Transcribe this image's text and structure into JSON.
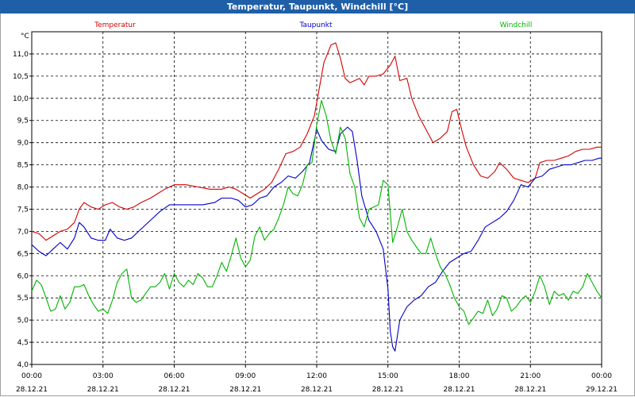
{
  "window": {
    "title": "Temperatur, Taupunkt, Windchill [°C]"
  },
  "colors": {
    "temperature": "#d40000",
    "dewpoint": "#0000c8",
    "windchill": "#00b400",
    "titlebar": "#1f5fa8",
    "grid": "#000000"
  },
  "chart_data": {
    "type": "line",
    "title": "Temperatur, Taupunkt, Windchill [°C]",
    "ylabel": "°C",
    "ylim": [
      4.0,
      11.5
    ],
    "xlim": [
      0,
      24
    ],
    "grid": true,
    "legend_position": "top",
    "y_ticks": [
      "4,0",
      "4,5",
      "5,0",
      "5,5",
      "6,0",
      "6,5",
      "7,0",
      "7,5",
      "8,0",
      "8,5",
      "9,0",
      "9,5",
      "10,0",
      "10,5",
      "11,0"
    ],
    "x_ticks": [
      {
        "time": "00:00",
        "date": "28.12.21"
      },
      {
        "time": "03:00",
        "date": "28.12.21"
      },
      {
        "time": "06:00",
        "date": "28.12.21"
      },
      {
        "time": "09:00",
        "date": "28.12.21"
      },
      {
        "time": "12:00",
        "date": "28.12.21"
      },
      {
        "time": "15:00",
        "date": "28.12.21"
      },
      {
        "time": "18:00",
        "date": "28.12.21"
      },
      {
        "time": "21:00",
        "date": "28.12.21"
      },
      {
        "time": "00:00",
        "date": "29.12.21"
      }
    ],
    "x_unit": "hours since 28.12.21 00:00",
    "series": [
      {
        "name": "Temperatur",
        "points": [
          [
            0,
            7.0
          ],
          [
            0.3,
            6.95
          ],
          [
            0.6,
            6.8
          ],
          [
            0.9,
            6.9
          ],
          [
            1.2,
            7.0
          ],
          [
            1.5,
            7.05
          ],
          [
            1.8,
            7.2
          ],
          [
            2.0,
            7.5
          ],
          [
            2.2,
            7.65
          ],
          [
            2.5,
            7.55
          ],
          [
            2.8,
            7.5
          ],
          [
            3.1,
            7.6
          ],
          [
            3.4,
            7.65
          ],
          [
            3.7,
            7.55
          ],
          [
            4.0,
            7.5
          ],
          [
            4.3,
            7.55
          ],
          [
            4.6,
            7.65
          ],
          [
            5.0,
            7.75
          ],
          [
            5.3,
            7.85
          ],
          [
            5.6,
            7.95
          ],
          [
            6.0,
            8.05
          ],
          [
            6.5,
            8.05
          ],
          [
            7.0,
            8.0
          ],
          [
            7.5,
            7.95
          ],
          [
            8.0,
            7.95
          ],
          [
            8.3,
            8.0
          ],
          [
            8.6,
            7.95
          ],
          [
            8.9,
            7.85
          ],
          [
            9.2,
            7.75
          ],
          [
            9.5,
            7.85
          ],
          [
            9.8,
            7.95
          ],
          [
            10.1,
            8.1
          ],
          [
            10.4,
            8.4
          ],
          [
            10.7,
            8.75
          ],
          [
            11.0,
            8.8
          ],
          [
            11.3,
            8.9
          ],
          [
            11.6,
            9.2
          ],
          [
            11.9,
            9.6
          ],
          [
            12.1,
            10.2
          ],
          [
            12.3,
            10.8
          ],
          [
            12.6,
            11.2
          ],
          [
            12.8,
            11.25
          ],
          [
            13.0,
            10.9
          ],
          [
            13.2,
            10.45
          ],
          [
            13.4,
            10.35
          ],
          [
            13.6,
            10.4
          ],
          [
            13.8,
            10.45
          ],
          [
            14.0,
            10.3
          ],
          [
            14.2,
            10.5
          ],
          [
            14.5,
            10.5
          ],
          [
            14.8,
            10.55
          ],
          [
            15.1,
            10.75
          ],
          [
            15.3,
            10.95
          ],
          [
            15.5,
            10.4
          ],
          [
            15.8,
            10.45
          ],
          [
            16.0,
            10.0
          ],
          [
            16.3,
            9.6
          ],
          [
            16.6,
            9.3
          ],
          [
            16.9,
            9.0
          ],
          [
            17.2,
            9.1
          ],
          [
            17.5,
            9.25
          ],
          [
            17.7,
            9.7
          ],
          [
            17.9,
            9.75
          ],
          [
            18.1,
            9.3
          ],
          [
            18.3,
            8.9
          ],
          [
            18.6,
            8.5
          ],
          [
            18.9,
            8.25
          ],
          [
            19.2,
            8.2
          ],
          [
            19.5,
            8.35
          ],
          [
            19.7,
            8.55
          ],
          [
            20.0,
            8.4
          ],
          [
            20.3,
            8.2
          ],
          [
            20.6,
            8.15
          ],
          [
            20.9,
            8.1
          ],
          [
            21.2,
            8.2
          ],
          [
            21.4,
            8.55
          ],
          [
            21.7,
            8.6
          ],
          [
            22.0,
            8.6
          ],
          [
            22.3,
            8.65
          ],
          [
            22.6,
            8.7
          ],
          [
            22.9,
            8.8
          ],
          [
            23.2,
            8.85
          ],
          [
            23.5,
            8.85
          ],
          [
            23.8,
            8.9
          ],
          [
            24.0,
            8.9
          ]
        ]
      },
      {
        "name": "Taupunkt",
        "points": [
          [
            0,
            6.7
          ],
          [
            0.3,
            6.55
          ],
          [
            0.6,
            6.45
          ],
          [
            0.9,
            6.6
          ],
          [
            1.2,
            6.75
          ],
          [
            1.5,
            6.6
          ],
          [
            1.8,
            6.85
          ],
          [
            2.0,
            7.2
          ],
          [
            2.2,
            7.1
          ],
          [
            2.5,
            6.85
          ],
          [
            2.8,
            6.8
          ],
          [
            3.1,
            6.8
          ],
          [
            3.3,
            7.05
          ],
          [
            3.6,
            6.85
          ],
          [
            3.9,
            6.8
          ],
          [
            4.2,
            6.85
          ],
          [
            4.5,
            7.0
          ],
          [
            4.8,
            7.15
          ],
          [
            5.1,
            7.3
          ],
          [
            5.4,
            7.45
          ],
          [
            5.8,
            7.6
          ],
          [
            6.2,
            7.6
          ],
          [
            6.7,
            7.6
          ],
          [
            7.2,
            7.6
          ],
          [
            7.7,
            7.65
          ],
          [
            8.0,
            7.75
          ],
          [
            8.4,
            7.75
          ],
          [
            8.7,
            7.7
          ],
          [
            9.0,
            7.55
          ],
          [
            9.3,
            7.6
          ],
          [
            9.6,
            7.75
          ],
          [
            9.9,
            7.8
          ],
          [
            10.2,
            8.0
          ],
          [
            10.5,
            8.1
          ],
          [
            10.8,
            8.25
          ],
          [
            11.1,
            8.2
          ],
          [
            11.4,
            8.35
          ],
          [
            11.7,
            8.55
          ],
          [
            12.0,
            9.3
          ],
          [
            12.2,
            9.05
          ],
          [
            12.5,
            8.85
          ],
          [
            12.8,
            8.8
          ],
          [
            13.0,
            9.2
          ],
          [
            13.3,
            9.35
          ],
          [
            13.5,
            9.25
          ],
          [
            13.7,
            8.6
          ],
          [
            13.9,
            7.8
          ],
          [
            14.2,
            7.25
          ],
          [
            14.5,
            7.0
          ],
          [
            14.8,
            6.6
          ],
          [
            15.0,
            5.7
          ],
          [
            15.1,
            4.75
          ],
          [
            15.2,
            4.4
          ],
          [
            15.3,
            4.3
          ],
          [
            15.5,
            5.0
          ],
          [
            15.8,
            5.3
          ],
          [
            16.1,
            5.45
          ],
          [
            16.4,
            5.55
          ],
          [
            16.7,
            5.75
          ],
          [
            17.0,
            5.85
          ],
          [
            17.3,
            6.1
          ],
          [
            17.6,
            6.3
          ],
          [
            17.9,
            6.4
          ],
          [
            18.2,
            6.5
          ],
          [
            18.5,
            6.55
          ],
          [
            18.8,
            6.8
          ],
          [
            19.1,
            7.1
          ],
          [
            19.4,
            7.2
          ],
          [
            19.7,
            7.3
          ],
          [
            20.0,
            7.45
          ],
          [
            20.3,
            7.7
          ],
          [
            20.6,
            8.05
          ],
          [
            20.9,
            8.0
          ],
          [
            21.2,
            8.2
          ],
          [
            21.5,
            8.25
          ],
          [
            21.8,
            8.4
          ],
          [
            22.1,
            8.45
          ],
          [
            22.4,
            8.5
          ],
          [
            22.7,
            8.5
          ],
          [
            23.0,
            8.55
          ],
          [
            23.3,
            8.6
          ],
          [
            23.6,
            8.6
          ],
          [
            23.9,
            8.65
          ],
          [
            24.0,
            8.65
          ]
        ]
      },
      {
        "name": "Windchill",
        "points": [
          [
            0,
            5.65
          ],
          [
            0.2,
            5.9
          ],
          [
            0.4,
            5.8
          ],
          [
            0.6,
            5.5
          ],
          [
            0.8,
            5.2
          ],
          [
            1.0,
            5.25
          ],
          [
            1.2,
            5.55
          ],
          [
            1.4,
            5.25
          ],
          [
            1.6,
            5.4
          ],
          [
            1.8,
            5.75
          ],
          [
            2.0,
            5.75
          ],
          [
            2.2,
            5.8
          ],
          [
            2.4,
            5.55
          ],
          [
            2.6,
            5.35
          ],
          [
            2.8,
            5.2
          ],
          [
            3.0,
            5.25
          ],
          [
            3.2,
            5.15
          ],
          [
            3.4,
            5.45
          ],
          [
            3.6,
            5.85
          ],
          [
            3.8,
            6.05
          ],
          [
            4.0,
            6.15
          ],
          [
            4.2,
            5.5
          ],
          [
            4.4,
            5.4
          ],
          [
            4.6,
            5.45
          ],
          [
            4.8,
            5.6
          ],
          [
            5.0,
            5.75
          ],
          [
            5.2,
            5.75
          ],
          [
            5.4,
            5.85
          ],
          [
            5.6,
            6.05
          ],
          [
            5.8,
            5.7
          ],
          [
            6.0,
            6.05
          ],
          [
            6.2,
            5.85
          ],
          [
            6.4,
            5.75
          ],
          [
            6.6,
            5.9
          ],
          [
            6.8,
            5.8
          ],
          [
            7.0,
            6.05
          ],
          [
            7.2,
            5.95
          ],
          [
            7.4,
            5.75
          ],
          [
            7.6,
            5.75
          ],
          [
            7.8,
            6.0
          ],
          [
            8.0,
            6.3
          ],
          [
            8.2,
            6.1
          ],
          [
            8.4,
            6.45
          ],
          [
            8.6,
            6.85
          ],
          [
            8.8,
            6.4
          ],
          [
            9.0,
            6.2
          ],
          [
            9.2,
            6.35
          ],
          [
            9.4,
            6.9
          ],
          [
            9.6,
            7.1
          ],
          [
            9.8,
            6.8
          ],
          [
            10.0,
            6.95
          ],
          [
            10.2,
            7.05
          ],
          [
            10.4,
            7.3
          ],
          [
            10.6,
            7.6
          ],
          [
            10.8,
            8.0
          ],
          [
            11.0,
            7.85
          ],
          [
            11.2,
            7.8
          ],
          [
            11.4,
            8.05
          ],
          [
            11.6,
            8.5
          ],
          [
            11.8,
            8.55
          ],
          [
            12.0,
            9.4
          ],
          [
            12.2,
            9.95
          ],
          [
            12.4,
            9.6
          ],
          [
            12.6,
            9.05
          ],
          [
            12.8,
            8.75
          ],
          [
            13.0,
            9.35
          ],
          [
            13.2,
            9.1
          ],
          [
            13.4,
            8.3
          ],
          [
            13.6,
            8.0
          ],
          [
            13.8,
            7.3
          ],
          [
            14.0,
            7.1
          ],
          [
            14.2,
            7.5
          ],
          [
            14.4,
            7.55
          ],
          [
            14.6,
            7.6
          ],
          [
            14.8,
            8.15
          ],
          [
            15.0,
            8.05
          ],
          [
            15.2,
            6.75
          ],
          [
            15.4,
            7.1
          ],
          [
            15.6,
            7.5
          ],
          [
            15.8,
            7.0
          ],
          [
            16.0,
            6.8
          ],
          [
            16.2,
            6.65
          ],
          [
            16.4,
            6.5
          ],
          [
            16.6,
            6.5
          ],
          [
            16.8,
            6.85
          ],
          [
            17.0,
            6.5
          ],
          [
            17.2,
            6.2
          ],
          [
            17.4,
            6.05
          ],
          [
            17.6,
            5.8
          ],
          [
            17.8,
            5.5
          ],
          [
            18.0,
            5.3
          ],
          [
            18.2,
            5.2
          ],
          [
            18.4,
            4.9
          ],
          [
            18.6,
            5.05
          ],
          [
            18.8,
            5.2
          ],
          [
            19.0,
            5.15
          ],
          [
            19.2,
            5.45
          ],
          [
            19.4,
            5.1
          ],
          [
            19.6,
            5.25
          ],
          [
            19.8,
            5.55
          ],
          [
            20.0,
            5.5
          ],
          [
            20.2,
            5.2
          ],
          [
            20.4,
            5.3
          ],
          [
            20.6,
            5.45
          ],
          [
            20.8,
            5.55
          ],
          [
            21.0,
            5.4
          ],
          [
            21.2,
            5.65
          ],
          [
            21.4,
            6.0
          ],
          [
            21.6,
            5.75
          ],
          [
            21.8,
            5.35
          ],
          [
            22.0,
            5.65
          ],
          [
            22.2,
            5.55
          ],
          [
            22.4,
            5.6
          ],
          [
            22.6,
            5.45
          ],
          [
            22.8,
            5.65
          ],
          [
            23.0,
            5.6
          ],
          [
            23.2,
            5.75
          ],
          [
            23.4,
            6.05
          ],
          [
            23.6,
            5.85
          ],
          [
            23.8,
            5.65
          ],
          [
            24.0,
            5.5
          ]
        ]
      }
    ]
  }
}
